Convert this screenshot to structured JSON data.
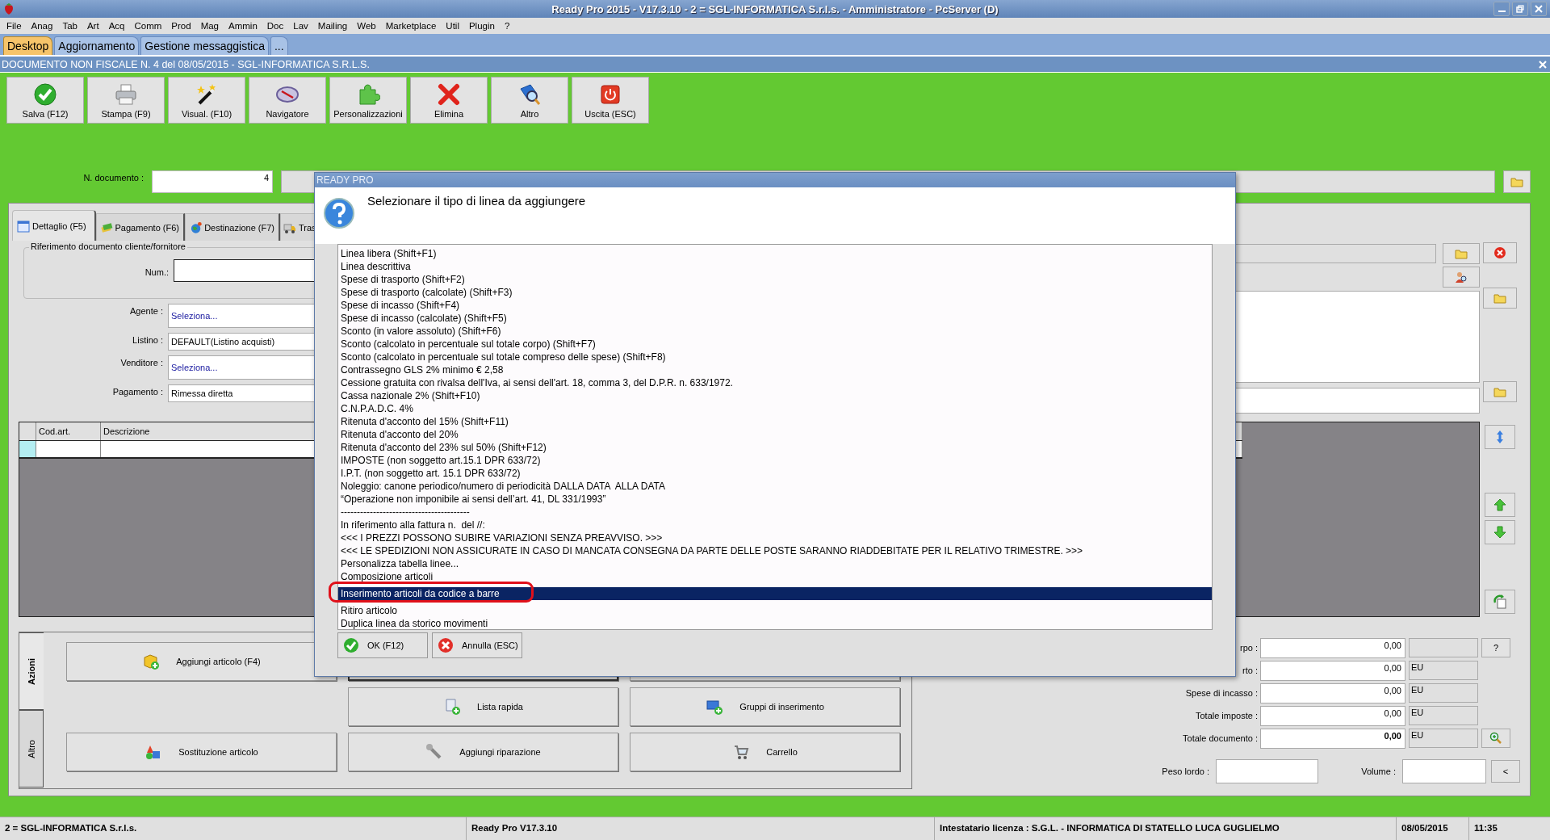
{
  "window": {
    "title": "Ready Pro 2015 - V17.3.10 - 2 = SGL-INFORMATICA S.r.l.s. - Amministratore - PcServer (D)"
  },
  "menu": [
    "File",
    "Anag",
    "Tab",
    "Art",
    "Acq",
    "Comm",
    "Prod",
    "Mag",
    "Ammin",
    "Doc",
    "Lav",
    "Mailing",
    "Web",
    "Marketplace",
    "Util",
    "Plugin",
    "?"
  ],
  "app_tabs": [
    {
      "label": "Desktop",
      "selected": true
    },
    {
      "label": "Aggiornamento",
      "selected": false
    },
    {
      "label": "Gestione messaggistica",
      "selected": false
    },
    {
      "label": "...",
      "selected": false
    }
  ],
  "document_title": "DOCUMENTO NON FISCALE N. 4 del 08/05/2015 - SGL-INFORMATICA S.R.L.S.",
  "toolbar": [
    {
      "label": "Salva (F12)",
      "kind": "save"
    },
    {
      "label": "Stampa (F9)",
      "kind": "print"
    },
    {
      "label": "Visual. (F10)",
      "kind": "wand"
    },
    {
      "label": "Navigatore",
      "kind": "navigator"
    },
    {
      "label": "Personalizzazioni",
      "kind": "puzzle"
    },
    {
      "label": "Elimina",
      "kind": "delete"
    },
    {
      "label": "Altro",
      "kind": "other"
    },
    {
      "label": "Uscita (ESC)",
      "kind": "exit"
    }
  ],
  "document_number": {
    "label": "N. documento :",
    "value": "4"
  },
  "form_tabs": [
    {
      "label": "Dettaglio (F5)",
      "selected": true,
      "kind": "calendar"
    },
    {
      "label": "Pagamento (F6)",
      "selected": false,
      "kind": "money"
    },
    {
      "label": "Destinazione (F7)",
      "selected": false,
      "kind": "globe"
    },
    {
      "label": "Tras",
      "selected": false,
      "kind": "truck"
    }
  ],
  "reference_group": {
    "title": "Riferimento documento cliente/fornitore",
    "num_label": "Num.:"
  },
  "fields": [
    {
      "label": "Agente :",
      "value": "Seleziona...",
      "kind": "select"
    },
    {
      "label": "Listino :",
      "value": "DEFAULT(Listino acquisti)",
      "kind": "text"
    },
    {
      "label": "Venditore :",
      "value": "Seleziona...",
      "kind": "select"
    },
    {
      "label": "Pagamento :",
      "value": "Rimessa diretta",
      "kind": "text"
    }
  ],
  "grid": {
    "columns": [
      "Cod.art.",
      "Descrizione"
    ]
  },
  "dialog": {
    "title": "READY PRO",
    "message": "Selezionare il tipo di linea da aggiungere",
    "highlight": true,
    "items": [
      {
        "label": "Linea libera (Shift+F1)",
        "selected": false
      },
      {
        "label": "Linea descrittiva",
        "selected": false
      },
      {
        "label": "Spese di trasporto (Shift+F2)",
        "selected": false
      },
      {
        "label": "Spese di trasporto (calcolate) (Shift+F3)",
        "selected": false
      },
      {
        "label": "Spese di incasso (Shift+F4)",
        "selected": false
      },
      {
        "label": "Spese di incasso (calcolate) (Shift+F5)",
        "selected": false
      },
      {
        "label": "Sconto (in valore assoluto) (Shift+F6)",
        "selected": false
      },
      {
        "label": "Sconto (calcolato in percentuale sul totale corpo) (Shift+F7)",
        "selected": false
      },
      {
        "label": "Sconto (calcolato in percentuale sul totale compreso delle spese) (Shift+F8)",
        "selected": false
      },
      {
        "label": "Contrassegno GLS 2% minimo € 2,58",
        "selected": false
      },
      {
        "label": "Cessione gratuita con rivalsa dell'Iva, ai sensi dell'art. 18, comma 3, del D.P.R. n. 633/1972.",
        "selected": false
      },
      {
        "label": "Cassa nazionale 2% (Shift+F10)",
        "selected": false
      },
      {
        "label": "C.N.P.A.D.C. 4%",
        "selected": false
      },
      {
        "label": "Ritenuta d'acconto del 15% (Shift+F11)",
        "selected": false
      },
      {
        "label": "Ritenuta d'acconto del 20%",
        "selected": false
      },
      {
        "label": "Ritenuta d'acconto del 23% sul 50% (Shift+F12)",
        "selected": false
      },
      {
        "label": "IMPOSTE (non soggetto art.15.1 DPR 633/72)",
        "selected": false
      },
      {
        "label": "I.P.T. (non soggetto art. 15.1 DPR 633/72)",
        "selected": false
      },
      {
        "label": "Noleggio: canone periodico/numero di periodicità DALLA DATA  ALLA DATA",
        "selected": false
      },
      {
        "label": "“Operazione non imponibile ai sensi dell’art. 41, DL 331/1993”",
        "selected": false
      },
      {
        "label": "----------------------------------------",
        "selected": false
      },
      {
        "label": "In riferimento alla fattura n.  del //:",
        "selected": false
      },
      {
        "label": "<<< I PREZZI POSSONO SUBIRE VARIAZIONI SENZA PREAVVISO. >>>",
        "selected": false
      },
      {
        "label": "<<< LE SPEDIZIONI NON ASSICURATE IN CASO DI MANCATA CONSEGNA DA PARTE DELLE POSTE SARANNO RIADDEBITATE PER IL RELATIVO TRIMESTRE. >>>",
        "selected": false
      },
      {
        "label": "Personalizza tabella linee...",
        "selected": false
      },
      {
        "label": "Composizione articoli",
        "selected": false
      },
      {
        "label": "Inserimento articoli da codice a barre",
        "selected": true
      },
      {
        "label": "Ritiro articolo",
        "selected": false
      },
      {
        "label": "Duplica linea da storico movimenti",
        "selected": false
      }
    ],
    "buttons": [
      {
        "label": "OK (F12)",
        "kind": "ok"
      },
      {
        "label": "Annulla (ESC)",
        "kind": "cancel"
      }
    ]
  },
  "side_tabs": [
    {
      "label": "Azioni",
      "selected": true
    },
    {
      "label": "Altro",
      "selected": false
    }
  ],
  "action_rows": [
    {
      "items": [
        {
          "label": "Aggiungi articolo (F4)",
          "kind": "box"
        },
        {
          "kind": "covered"
        },
        {
          "kind": "covered"
        }
      ]
    },
    {
      "items": [
        {
          "kind": "blank"
        },
        {
          "label": "Lista rapida",
          "kind": "list"
        },
        {
          "label": "Gruppi di inserimento",
          "kind": "group"
        }
      ]
    },
    {
      "items": [
        {
          "label": "Sostituzione articolo",
          "kind": "swap"
        },
        {
          "label": "Aggiungi riparazione",
          "kind": "wrench"
        },
        {
          "label": "Carrello",
          "kind": "cart"
        }
      ]
    }
  ],
  "totals": [
    {
      "label": "rpo :",
      "value": "0,00",
      "bold": false,
      "kind": "help",
      "button": "?"
    },
    {
      "label": "rto :",
      "value": "0,00",
      "bold": false,
      "kind": "plain",
      "unit": "EU"
    },
    {
      "label": "Spese di incasso :",
      "value": "0,00",
      "bold": false,
      "kind": "plain",
      "unit": "EU"
    },
    {
      "label": "Totale imposte :",
      "value": "0,00",
      "bold": false,
      "kind": "plain",
      "unit": "EU"
    },
    {
      "label": "Totale documento :",
      "value": "0,00",
      "bold": true,
      "kind": "zoom",
      "unit": "EU"
    }
  ],
  "weight": {
    "label": "Peso lordo :"
  },
  "volume": {
    "label": "Volume :"
  },
  "collapse_button": "<",
  "status_bar": [
    "2 = SGL-INFORMATICA S.r.l.s.",
    "Ready Pro V17.3.10",
    "Intestatario licenza : S.G.L. - INFORMATICA DI STATELLO LUCA GUGLIELMO",
    "08/05/2015",
    "11:35"
  ]
}
